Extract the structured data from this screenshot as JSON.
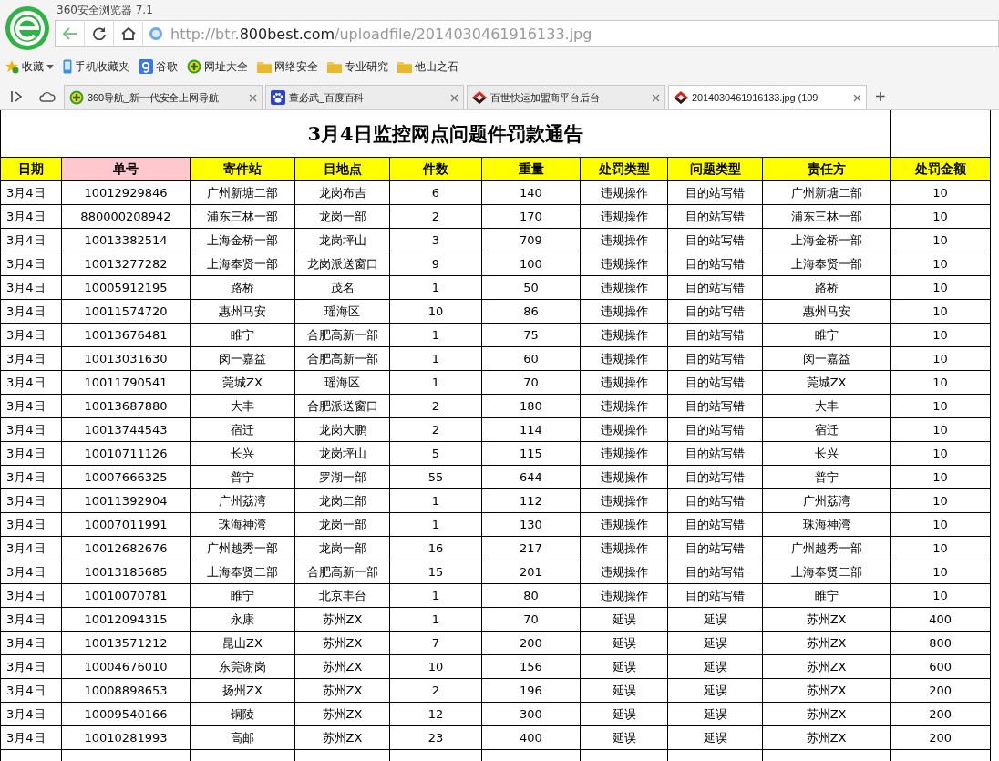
{
  "browser": {
    "title": "360安全浏览器 7.1",
    "url": {
      "prefix": "http://btr.",
      "domain": "800best.com",
      "path": "/uploadfile/2014030461916133.jpg"
    },
    "bookmarks": [
      {
        "label": "收藏",
        "kind": "star"
      },
      {
        "label": "手机收藏夹",
        "kind": "phone"
      },
      {
        "label": "谷歌",
        "kind": "google"
      },
      {
        "label": "网址大全",
        "kind": "plus"
      },
      {
        "label": "网络安全",
        "kind": "folder"
      },
      {
        "label": "专业研究",
        "kind": "folder"
      },
      {
        "label": "他山之石",
        "kind": "folder"
      }
    ],
    "tabs": [
      {
        "title": "360导航_新一代安全上网导航",
        "kind": "plus",
        "selected": false
      },
      {
        "title": "董必武_百度百科",
        "kind": "paw",
        "selected": false
      },
      {
        "title": "百世快运加盟商平台后台",
        "kind": "diamond",
        "selected": false
      },
      {
        "title": "2014030461916133.jpg (109",
        "kind": "diamond",
        "selected": true
      }
    ],
    "new_tab": "+"
  },
  "document": {
    "title": "3月4日监控网点问题件罚款通告",
    "columns": [
      {
        "label": "日期",
        "highlighted": false
      },
      {
        "label": "单号",
        "highlighted": true
      },
      {
        "label": "寄件站",
        "highlighted": false
      },
      {
        "label": "目地点",
        "highlighted": false
      },
      {
        "label": "件数",
        "highlighted": false
      },
      {
        "label": "重量",
        "highlighted": false
      },
      {
        "label": "处罚类型",
        "highlighted": false
      },
      {
        "label": "问题类型",
        "highlighted": false
      },
      {
        "label": "责任方",
        "highlighted": false
      },
      {
        "label": "处罚金额",
        "highlighted": false
      }
    ],
    "rows": [
      [
        "3月4日",
        "10012929846",
        "广州新塘二部",
        "龙岗布吉",
        "6",
        "140",
        "违规操作",
        "目的站写错",
        "广州新塘二部",
        "10"
      ],
      [
        "3月4日",
        "880000208942",
        "浦东三林一部",
        "龙岗一部",
        "2",
        "170",
        "违规操作",
        "目的站写错",
        "浦东三林一部",
        "10"
      ],
      [
        "3月4日",
        "10013382514",
        "上海金桥一部",
        "龙岗坪山",
        "3",
        "709",
        "违规操作",
        "目的站写错",
        "上海金桥一部",
        "10"
      ],
      [
        "3月4日",
        "10013277282",
        "上海奉贤一部",
        "龙岗派送窗口",
        "9",
        "100",
        "违规操作",
        "目的站写错",
        "上海奉贤一部",
        "10"
      ],
      [
        "3月4日",
        "10005912195",
        "路桥",
        "茂名",
        "1",
        "50",
        "违规操作",
        "目的站写错",
        "路桥",
        "10"
      ],
      [
        "3月4日",
        "10011574720",
        "惠州马安",
        "瑶海区",
        "10",
        "86",
        "违规操作",
        "目的站写错",
        "惠州马安",
        "10"
      ],
      [
        "3月4日",
        "10013676481",
        "睢宁",
        "合肥高新一部",
        "1",
        "75",
        "违规操作",
        "目的站写错",
        "睢宁",
        "10"
      ],
      [
        "3月4日",
        "10013031630",
        "闵一嘉益",
        "合肥高新一部",
        "1",
        "60",
        "违规操作",
        "目的站写错",
        "闵一嘉益",
        "10"
      ],
      [
        "3月4日",
        "10011790541",
        "莞城ZX",
        "瑶海区",
        "1",
        "70",
        "违规操作",
        "目的站写错",
        "莞城ZX",
        "10"
      ],
      [
        "3月4日",
        "10013687880",
        "大丰",
        "合肥派送窗口",
        "2",
        "180",
        "违规操作",
        "目的站写错",
        "大丰",
        "10"
      ],
      [
        "3月4日",
        "10013744543",
        "宿迁",
        "龙岗大鹏",
        "2",
        "114",
        "违规操作",
        "目的站写错",
        "宿迁",
        "10"
      ],
      [
        "3月4日",
        "10010711126",
        "长兴",
        "龙岗坪山",
        "5",
        "115",
        "违规操作",
        "目的站写错",
        "长兴",
        "10"
      ],
      [
        "3月4日",
        "10007666325",
        "普宁",
        "罗湖一部",
        "55",
        "644",
        "违规操作",
        "目的站写错",
        "普宁",
        "10"
      ],
      [
        "3月4日",
        "10011392904",
        "广州荔湾",
        "龙岗二部",
        "1",
        "112",
        "违规操作",
        "目的站写错",
        "广州荔湾",
        "10"
      ],
      [
        "3月4日",
        "10007011991",
        "珠海神湾",
        "龙岗一部",
        "1",
        "130",
        "违规操作",
        "目的站写错",
        "珠海神湾",
        "10"
      ],
      [
        "3月4日",
        "10012682676",
        "广州越秀一部",
        "龙岗一部",
        "16",
        "217",
        "违规操作",
        "目的站写错",
        "广州越秀一部",
        "10"
      ],
      [
        "3月4日",
        "10013185685",
        "上海奉贤二部",
        "合肥高新一部",
        "15",
        "201",
        "违规操作",
        "目的站写错",
        "上海奉贤二部",
        "10"
      ],
      [
        "3月4日",
        "10010070781",
        "睢宁",
        "北京丰台",
        "1",
        "80",
        "违规操作",
        "目的站写错",
        "睢宁",
        "10"
      ],
      [
        "3月4日",
        "10012094315",
        "永康",
        "苏州ZX",
        "1",
        "70",
        "延误",
        "延误",
        "苏州ZX",
        "400"
      ],
      [
        "3月4日",
        "10013571212",
        "昆山ZX",
        "苏州ZX",
        "7",
        "200",
        "延误",
        "延误",
        "苏州ZX",
        "800"
      ],
      [
        "3月4日",
        "10004676010",
        "东莞谢岗",
        "苏州ZX",
        "10",
        "156",
        "延误",
        "延误",
        "苏州ZX",
        "600"
      ],
      [
        "3月4日",
        "10008898653",
        "扬州ZX",
        "苏州ZX",
        "2",
        "196",
        "延误",
        "延误",
        "苏州ZX",
        "200"
      ],
      [
        "3月4日",
        "10009540166",
        "铜陵",
        "苏州ZX",
        "12",
        "300",
        "延误",
        "延误",
        "苏州ZX",
        "200"
      ],
      [
        "3月4日",
        "10010281993",
        "高邮",
        "苏州ZX",
        "23",
        "400",
        "延误",
        "延误",
        "苏州ZX",
        "200"
      ]
    ]
  }
}
